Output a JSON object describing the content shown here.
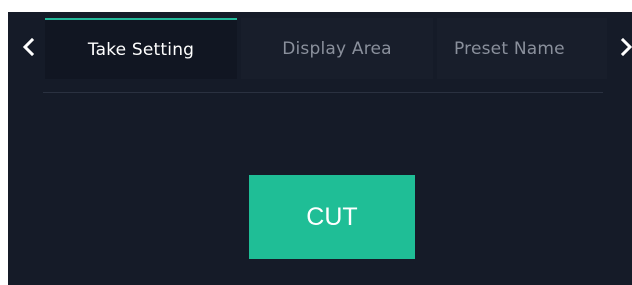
{
  "tabs": [
    {
      "label": "Take Setting",
      "active": true
    },
    {
      "label": "Display Area",
      "active": false
    },
    {
      "label": "Preset Name",
      "active": false
    }
  ],
  "nav": {
    "prev_icon": "chevron-left-icon",
    "next_icon": "chevron-right-icon"
  },
  "action": {
    "cut_label": "CUT"
  },
  "colors": {
    "background": "#151b28",
    "accent": "#23b99a",
    "button": "#1fbe96",
    "inactive_text": "#8a909c",
    "active_text": "#ffffff"
  }
}
